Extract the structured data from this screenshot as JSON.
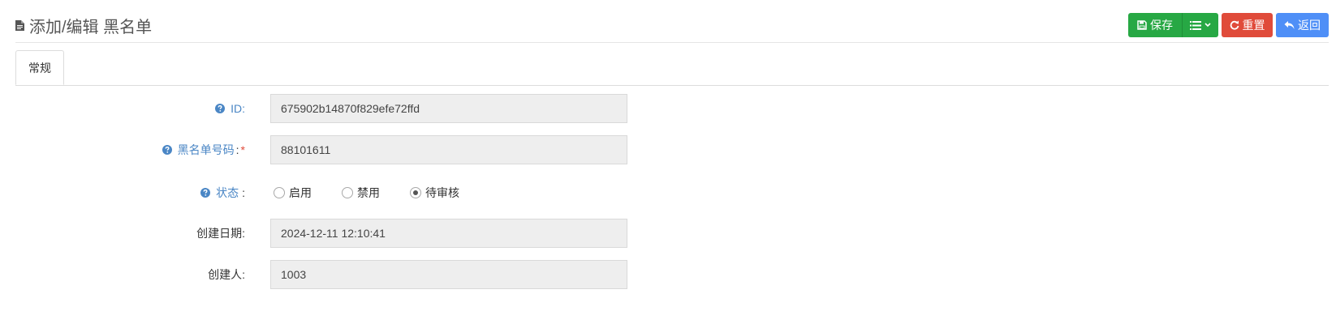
{
  "header": {
    "title": "添加/编辑 黑名单",
    "title_icon": "file-icon"
  },
  "toolbar": {
    "save_label": "保存",
    "reset_label": "重置",
    "back_label": "返回",
    "save_color": "#27a844",
    "reset_color": "#e04b3a",
    "back_color": "#4f8ff7"
  },
  "tabs": [
    {
      "label": "常规"
    }
  ],
  "form": {
    "id": {
      "label": "ID",
      "colon": ":",
      "value": "675902b14870f829efe72ffd"
    },
    "number": {
      "label": "黑名单号码",
      "colon": ":",
      "required": "*",
      "value": "88101611"
    },
    "status": {
      "label": "状态",
      "colon": ":",
      "options": [
        "启用",
        "禁用",
        "待审核"
      ],
      "selected": "待审核"
    },
    "created_date": {
      "label": "创建日期:",
      "value": "2024-12-11 12:10:41"
    },
    "creator": {
      "label": "创建人:",
      "value": "1003"
    }
  },
  "colors": {
    "label_blue": "#4a86c5",
    "required": "#e04b3a"
  }
}
